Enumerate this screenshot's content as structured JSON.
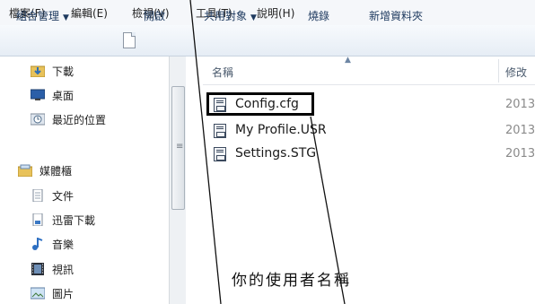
{
  "menubar": {
    "items": [
      "檔案(F)",
      "編輯(E)",
      "檢視(V)",
      "工具(T)",
      "說明(H)"
    ]
  },
  "toolbar": {
    "organize": "組合管理",
    "open": "開啟",
    "share": "共用對象",
    "burn": "燒錄",
    "new_folder": "新增資料夾"
  },
  "nav": {
    "favorites": [
      "下載",
      "桌面",
      "最近的位置"
    ],
    "libraries_label": "媒體櫃",
    "libraries": [
      "文件",
      "迅雷下載",
      "音樂",
      "視訊",
      "圖片"
    ]
  },
  "filelist": {
    "col_name": "名稱",
    "col_date": "修改",
    "files": [
      {
        "name": "Config.cfg",
        "date": "2013"
      },
      {
        "name": "My Profile.USR",
        "date": "2013"
      },
      {
        "name": "Settings.STG",
        "date": "2013"
      }
    ]
  },
  "annotation": {
    "text": "你的使用者名稱",
    "color": "#000000"
  },
  "colors": {
    "toolbar_text": "#1e3a5f",
    "header_text": "#4b5b6e"
  }
}
